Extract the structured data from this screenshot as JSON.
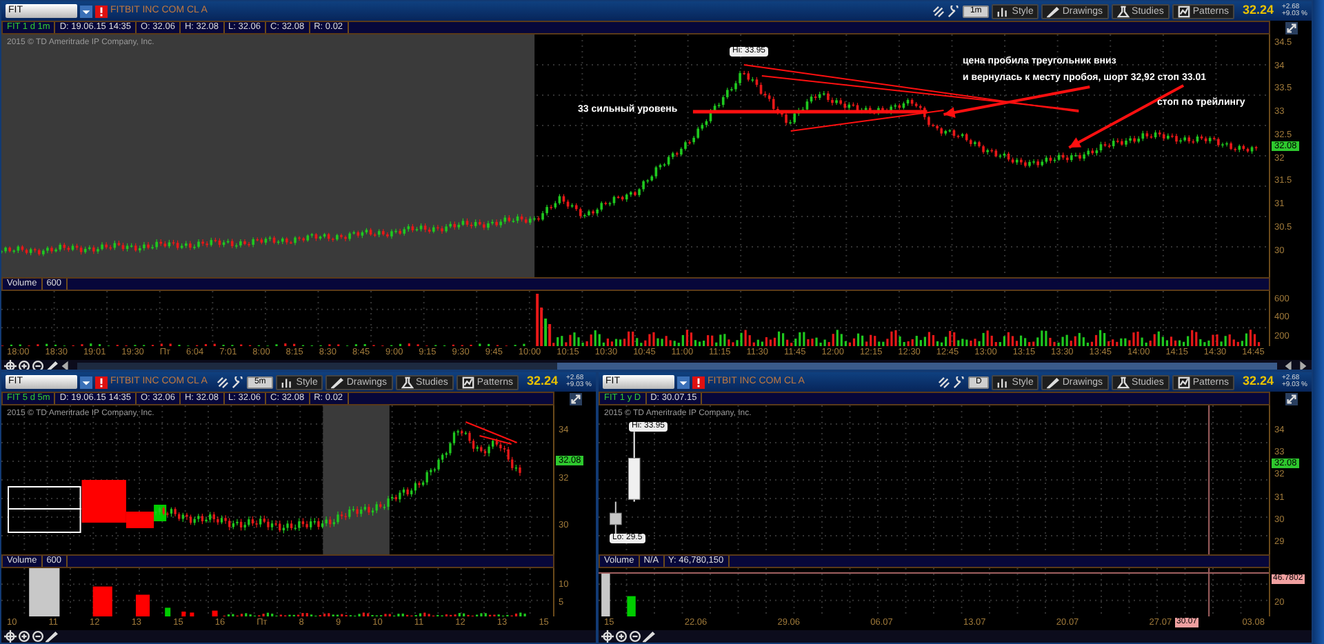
{
  "panels": [
    {
      "kind": "intraday",
      "symbol": "FIT",
      "company": "FITBIT INC COM CL A",
      "timeframe": "1m",
      "tools": [
        "Style",
        "Drawings",
        "Studies",
        "Patterns"
      ],
      "last_price": "32.24",
      "change": "+2.68",
      "change_pct": "+9.03 %",
      "info": [
        "FIT 1 d 1m",
        "D: 19.06.15 14:35",
        "O: 32.06",
        "H: 32.08",
        "L: 32.06",
        "C: 32.08",
        "R: 0.02"
      ],
      "copyright": "2015 © TD Ameritrade IP Company, Inc.",
      "markers": [
        "Hi: 33.95"
      ],
      "price_ticks": [
        "34.5",
        "34",
        "33.5",
        "33",
        "32.5",
        "32",
        "31.5",
        "31",
        "30.5",
        "30"
      ],
      "price_tag": "32.08",
      "annotations": [
        "33 сильный уровень",
        "цена пробила треугольник вниз",
        "и вернулась к месту пробоя, шорт 32,92 стоп 33.01",
        "стоп по трейлингу"
      ],
      "volume_labels": [
        "Volume",
        "600"
      ],
      "volume_ticks": [
        "600",
        "400",
        "200"
      ],
      "time_ticks": [
        "18:00",
        "18:30",
        "19:01",
        "19:30",
        "Пт",
        "6:04",
        "7:01",
        "8:00",
        "8:15",
        "8:30",
        "8:45",
        "9:00",
        "9:15",
        "9:30",
        "9:45",
        "10:00",
        "10:15",
        "10:30",
        "10:45",
        "11:00",
        "11:15",
        "11:30",
        "11:45",
        "12:00",
        "12:15",
        "12:30",
        "12:45",
        "13:00",
        "13:15",
        "13:30",
        "13:45",
        "14:00",
        "14:15",
        "14:30",
        "14:45"
      ]
    },
    {
      "kind": "five_day",
      "symbol": "FIT",
      "company": "FITBIT INC COM CL A",
      "timeframe": "5m",
      "tools": [
        "Style",
        "Drawings",
        "Studies",
        "Patterns"
      ],
      "last_price": "32.24",
      "change": "+2.68",
      "change_pct": "+9.03 %",
      "info": [
        "FIT 5 d 5m",
        "D: 19.06.15 14:35",
        "O: 32.06",
        "H: 32.08",
        "L: 32.06",
        "C: 32.08",
        "R: 0.02"
      ],
      "copyright": "2015 © TD Ameritrade IP Company, Inc.",
      "price_ticks": [
        "34",
        "32",
        "30"
      ],
      "price_tag": "32.08",
      "volume_labels": [
        "Volume",
        "600"
      ],
      "volume_ticks": [
        "10",
        "5"
      ],
      "time_ticks": [
        "10",
        "11",
        "12",
        "13",
        "15",
        "16",
        "Пт",
        "8",
        "9",
        "10",
        "11",
        "12",
        "13",
        "15"
      ]
    },
    {
      "kind": "yearly",
      "symbol": "FIT",
      "company": "FITBIT INC COM CL A",
      "timeframe": "D",
      "tools": [
        "Style",
        "Drawings",
        "Studies",
        "Patterns"
      ],
      "last_price": "32.24",
      "change": "+2.68",
      "change_pct": "+9.03 %",
      "info": [
        "FIT 1 y D",
        "D: 30.07.15"
      ],
      "copyright": "2015 © TD Ameritrade IP Company, Inc.",
      "markers": [
        "Hi: 33.95",
        "Lo: 29.5"
      ],
      "price_ticks": [
        "34",
        "33",
        "32",
        "31",
        "30",
        "29"
      ],
      "price_tag": "32.08",
      "volume_labels": [
        "Volume",
        "N/A",
        "Y: 46,780,150"
      ],
      "volume_ticks": [
        "20"
      ],
      "volume_tag": "46.7802",
      "time_ticks": [
        "15",
        "22.06",
        "29.06",
        "06.07",
        "13.07",
        "20.07",
        "27.07",
        "03.08"
      ],
      "cursor_tag": "30.07"
    }
  ]
}
